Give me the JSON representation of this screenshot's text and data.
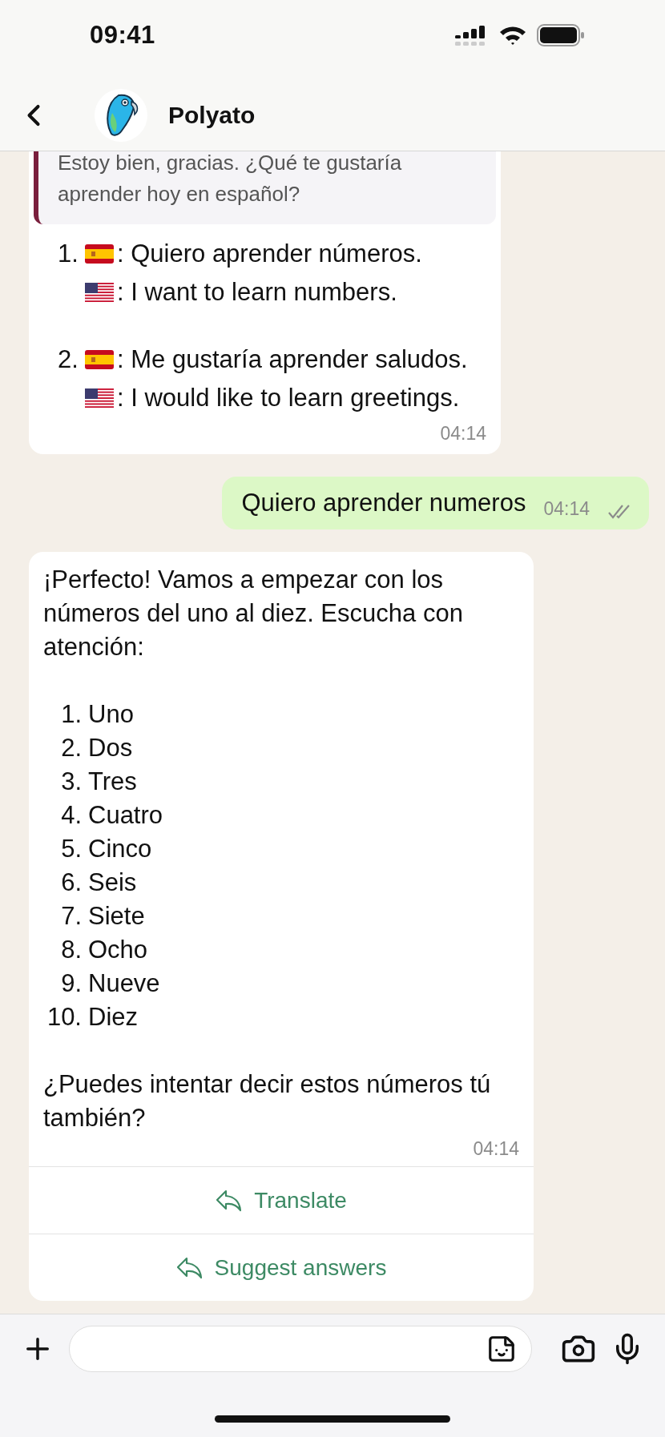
{
  "status_bar": {
    "time": "09:41"
  },
  "header": {
    "title": "Polyato"
  },
  "messages": [
    {
      "kind": "received",
      "quote": {
        "text": "Estoy bien, gracias. ¿Qué te gustaría aprender hoy en español?"
      },
      "options": [
        {
          "number": "1.",
          "spanish": ": Quiero aprender números.",
          "english": ": I want to learn numbers."
        },
        {
          "number": "2.",
          "spanish": ": Me gustaría aprender saludos.",
          "english": ": I would like to learn greetings."
        }
      ],
      "time": "04:14"
    },
    {
      "kind": "sent",
      "text": "Quiero aprender numeros",
      "time": "04:14",
      "read": false
    },
    {
      "kind": "lesson",
      "intro": "¡Perfecto! Vamos a empezar con los números del uno al diez. Escucha con atención:",
      "items": [
        {
          "number": "1.",
          "text": "Uno"
        },
        {
          "number": "2.",
          "text": "Dos"
        },
        {
          "number": "3.",
          "text": "Tres"
        },
        {
          "number": "4.",
          "text": "Cuatro"
        },
        {
          "number": "5.",
          "text": "Cinco"
        },
        {
          "number": "6.",
          "text": "Seis"
        },
        {
          "number": "7.",
          "text": "Siete"
        },
        {
          "number": "8.",
          "text": "Ocho"
        },
        {
          "number": "9.",
          "text": "Nueve"
        },
        {
          "number": "10.",
          "text": "Diez"
        }
      ],
      "closing": "¿Puedes intentar decir estos números tú también?",
      "time": "04:14",
      "actions": [
        {
          "label": "Translate"
        },
        {
          "label": "Suggest answers"
        }
      ]
    }
  ]
}
